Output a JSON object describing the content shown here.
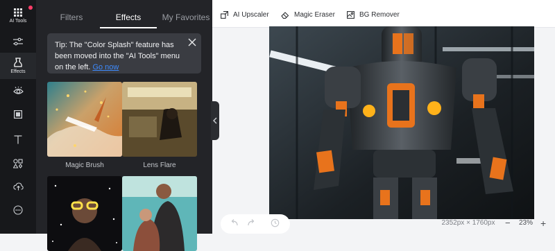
{
  "rail": {
    "ai_tools_label": "AI Tools",
    "effects_label": "Effects",
    "icons": [
      "grid-icon",
      "sliders-icon",
      "effects-icon",
      "eye-icon",
      "frame-icon",
      "text-icon",
      "elements-icon",
      "upload-icon",
      "more-icon"
    ]
  },
  "panel": {
    "tabs": [
      "Filters",
      "Effects",
      "My Favorites"
    ],
    "active_tab": "Effects",
    "tip": {
      "text": "Tip: The \"Color Splash\" feature has been moved into the \"AI Tools\" menu on the left.",
      "link": "Go now"
    },
    "effects": [
      {
        "label": "Magic Brush"
      },
      {
        "label": "Lens Flare"
      },
      {
        "label": ""
      },
      {
        "label": ""
      }
    ]
  },
  "toolbar": {
    "ai_upscaler": "AI Upscaler",
    "magic_eraser": "Magic Eraser",
    "bg_remover": "BG Remover"
  },
  "status": {
    "image_size": "2352px × 1760px",
    "zoom": "23%",
    "zoom_minus": "−",
    "zoom_plus": "+"
  },
  "colors": {
    "accent": "#3d8bff",
    "robot_orange": "#e8731c",
    "notification": "#ff3d68"
  }
}
